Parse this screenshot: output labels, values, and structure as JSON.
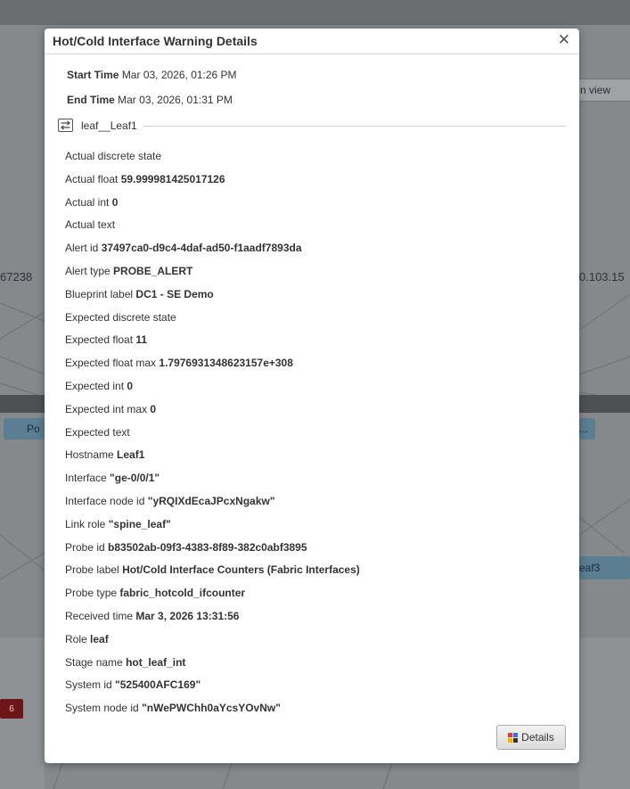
{
  "background": {
    "left_number": "67238",
    "right_number": "0.103.15",
    "view_button": "n view",
    "pod_label": "Po",
    "ellipsis": "...",
    "leaf3_label": "eaf3",
    "red_count": "6"
  },
  "modal": {
    "title": "Hot/Cold Interface Warning Details",
    "start_time_label": "Start Time",
    "start_time_value": "Mar 03, 2026, 01:26 PM",
    "end_time_label": "End Time",
    "end_time_value": "Mar 03, 2026, 01:31 PM",
    "section_label": "leaf__Leaf1",
    "details_button": "Details",
    "properties": [
      {
        "key": "Actual discrete state",
        "value": ""
      },
      {
        "key": "Actual float",
        "value": "59.999981425017126"
      },
      {
        "key": "Actual int",
        "value": "0"
      },
      {
        "key": "Actual text",
        "value": ""
      },
      {
        "key": "Alert id",
        "value": "37497ca0-d9c4-4daf-ad50-f1aadf7893da"
      },
      {
        "key": "Alert type",
        "value": "PROBE_ALERT"
      },
      {
        "key": "Blueprint label",
        "value": "DC1 - SE Demo"
      },
      {
        "key": "Expected discrete state",
        "value": ""
      },
      {
        "key": "Expected float",
        "value": "11"
      },
      {
        "key": "Expected float max",
        "value": "1.7976931348623157e+308"
      },
      {
        "key": "Expected int",
        "value": "0"
      },
      {
        "key": "Expected int max",
        "value": "0"
      },
      {
        "key": "Expected text",
        "value": ""
      },
      {
        "key": "Hostname",
        "value": "Leaf1"
      },
      {
        "key": "Interface",
        "value": "\"ge-0/0/1\""
      },
      {
        "key": "Interface node id",
        "value": "\"yRQIXdEcaJPcxNgakw\""
      },
      {
        "key": "Link role",
        "value": "\"spine_leaf\""
      },
      {
        "key": "Probe id",
        "value": "b83502ab-09f3-4383-8f89-382c0abf3895"
      },
      {
        "key": "Probe label",
        "value": "Hot/Cold Interface Counters (Fabric Interfaces)"
      },
      {
        "key": "Probe type",
        "value": "fabric_hotcold_ifcounter"
      },
      {
        "key": "Received time",
        "value": "Mar 3, 2026 13:31:56"
      },
      {
        "key": "Role",
        "value": "leaf"
      },
      {
        "key": "Stage name",
        "value": "hot_leaf_int"
      },
      {
        "key": "System id",
        "value": "\"525400AFC169\""
      },
      {
        "key": "System node id",
        "value": "\"nWePWChh0aYcsYOvNw\""
      }
    ]
  }
}
